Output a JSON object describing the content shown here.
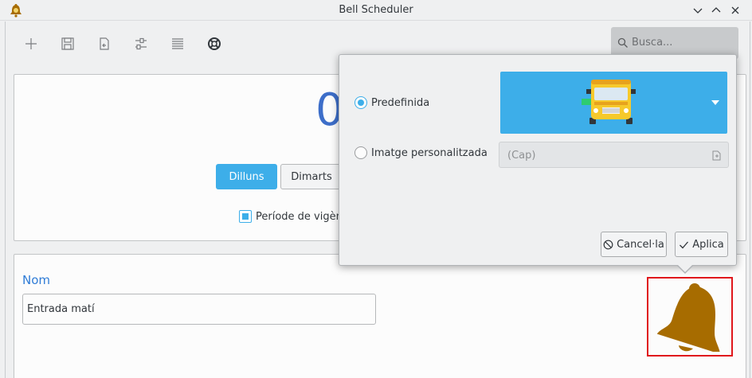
{
  "window": {
    "title": "Bell Scheduler"
  },
  "toolbar": {
    "items": [
      {
        "icon": "plus-icon"
      },
      {
        "icon": "save-icon"
      },
      {
        "icon": "import-icon"
      },
      {
        "icon": "settings-sliders-icon"
      },
      {
        "icon": "list-icon"
      },
      {
        "icon": "help-lifebuoy-icon"
      }
    ]
  },
  "search": {
    "placeholder": "Busca..."
  },
  "schedule": {
    "time_partial": "0",
    "days": [
      {
        "label": "Dilluns",
        "active": true
      },
      {
        "label": "Dimarts",
        "active": false
      }
    ],
    "period_label": "Període de vigèn",
    "period_checked": true
  },
  "bell": {
    "name_label": "Nom",
    "name_value": "Entrada matí",
    "icon": "bell-icon",
    "bell_color": "#a76c00"
  },
  "image_popup": {
    "predefined_label": "Predefinida",
    "custom_label": "Imatge personalitzada",
    "predefined_checked": true,
    "selected_image": "school-bus-icon",
    "file_placeholder": "(Cap)",
    "cancel_label": "Cancel·la",
    "apply_label": "Aplica"
  },
  "colors": {
    "accent": "#3daee9",
    "highlight_border": "#e0171c",
    "heading_blue": "#2f7cd6"
  }
}
